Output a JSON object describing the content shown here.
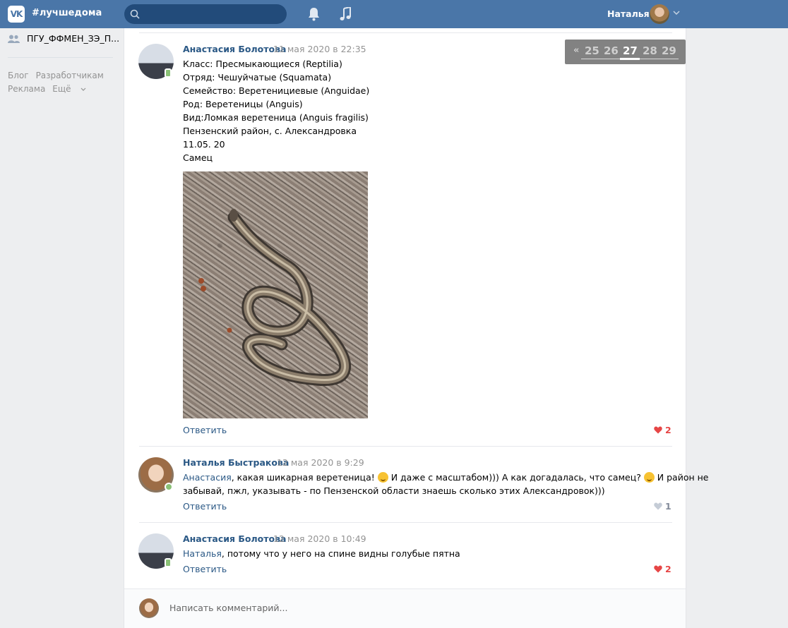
{
  "header": {
    "logo": "VK",
    "title": "#лучшедома",
    "search_placeholder": "",
    "username": "Наталья",
    "icons": [
      "search-icon",
      "bell-icon",
      "music-icon",
      "chevron-down-icon"
    ]
  },
  "sidebar": {
    "group": "ПГУ_ФФМЕН_ЗЭ_П...",
    "links_row1": [
      "Блог",
      "Разработчикам"
    ],
    "links_row2": [
      "Реклама",
      "Ещё"
    ]
  },
  "pager": {
    "prev": "«",
    "pages": [
      "25",
      "26",
      "27",
      "28",
      "29"
    ],
    "current": "27"
  },
  "comments": [
    {
      "author": "Анастасия Болотова",
      "date": "11 мая 2020 в 22:35",
      "lines": [
        "Класс: Пресмыкающиеся (Reptilia)",
        "Отряд: Чешуйчатые (Squamata)",
        "Семейство: Веретенициевые (Anguidae)",
        "Род: Веретеницы (Anguis)",
        "Вид:Ломкая веретеница (Anguis fragilis)",
        "Пензенский район, с. Александровка",
        "11.05. 20",
        "Самец"
      ],
      "reply": "Ответить",
      "likes": "2"
    },
    {
      "author": "Наталья Быстракова",
      "date": "12 мая 2020 в 9:29",
      "mention": "Анастасия",
      "text1": ", какая шикарная веретеница!",
      "text2": " И даже с масштабом))) А как догадалась, что самец?",
      "text3": " И район не",
      "line2": "забывай, пжл, указывать - по Пензенской области знаешь сколько этих Александровок)))",
      "reply": "Ответить",
      "likes": "1"
    },
    {
      "author": "Анастасия Болотова",
      "date": "12 мая 2020 в 10:49",
      "mention": "Наталья",
      "text": ", потому что у него на спине видны голубые пятна",
      "reply": "Ответить",
      "likes": "2"
    }
  ],
  "composer": {
    "placeholder": "Написать комментарий..."
  },
  "colors": {
    "header_bg": "#4a76a8",
    "link": "#2a5885",
    "like_active": "#e64646",
    "page_bg": "#edeef0"
  }
}
